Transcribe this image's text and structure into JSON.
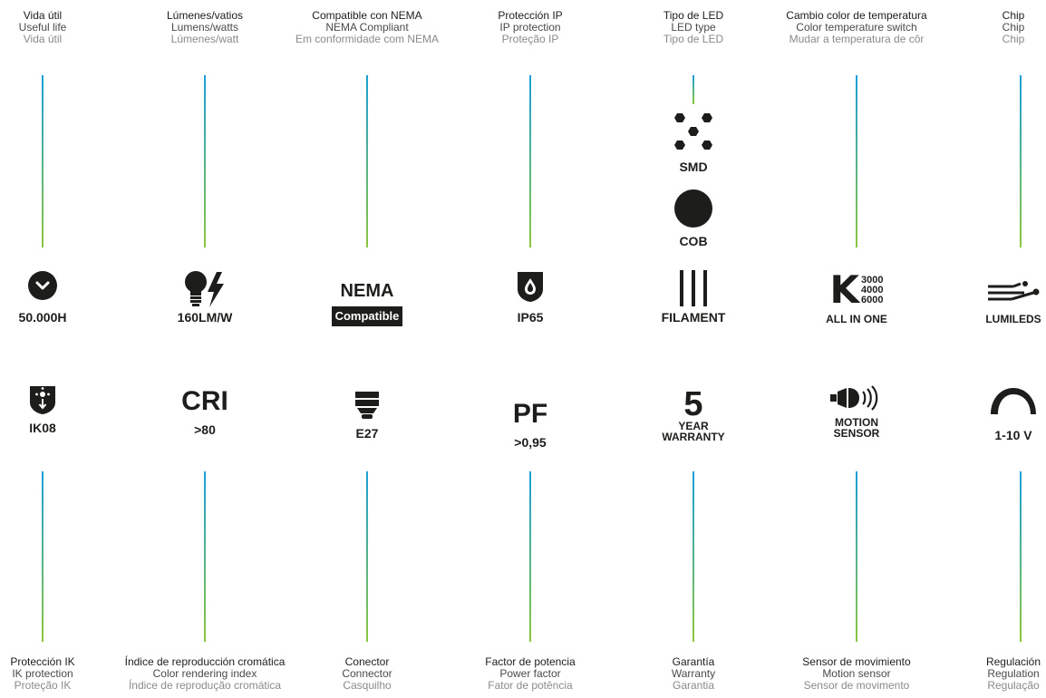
{
  "columns": [
    {
      "top": {
        "es": "Vida útil",
        "en": "Useful life",
        "pt": "Vida útil"
      },
      "top_feature": {
        "icon": "clock-icon",
        "value": "50.000H"
      },
      "bottom_feature": {
        "icon": "impact-shield-icon",
        "value": "IK08"
      },
      "bottom": {
        "es": "Protección IK",
        "en": "IK protection",
        "pt": "Proteção IK"
      }
    },
    {
      "top": {
        "es": "Lúmenes/vatios",
        "en": "Lumens/watts",
        "pt": "Lúmenes/watt"
      },
      "top_feature": {
        "icon": "bulb-lightning-icon",
        "value": "160LM/W"
      },
      "bottom_feature": {
        "icon": "cri-text-icon",
        "big": "CRI",
        "value": ">80"
      },
      "bottom": {
        "es": "Índice de reproducción cromática",
        "en": "Color rendering index",
        "pt": "Índice de reprodução cromática"
      }
    },
    {
      "top": {
        "es": "Compatible con NEMA",
        "en": "NEMA Compliant",
        "pt": "Em conformidade com NEMA"
      },
      "top_feature": {
        "title": "NEMA",
        "badge": "Compatible"
      },
      "bottom_feature": {
        "icon": "e27-socket-icon",
        "value": "E27"
      },
      "bottom": {
        "es": "Conector",
        "en": "Connector",
        "pt": "Casquilho"
      }
    },
    {
      "top": {
        "es": "Protección IP",
        "en": "IP protection",
        "pt": "Proteção IP"
      },
      "top_feature": {
        "icon": "water-drop-shield-icon",
        "value": "IP65"
      },
      "bottom_feature": {
        "icon": "pf-text-icon",
        "big": "PF",
        "value": ">0,95"
      },
      "bottom": {
        "es": "Factor de potencia",
        "en": "Power factor",
        "pt": "Fator de potência"
      }
    },
    {
      "top": {
        "es": "Tipo de LED",
        "en": "LED type",
        "pt": "Tipo de LED"
      },
      "led_types": [
        {
          "icon": "smd-hexagons-icon",
          "value": "SMD"
        },
        {
          "icon": "cob-circle-icon",
          "value": "COB"
        }
      ],
      "top_feature": {
        "icon": "filament-lines-icon",
        "value": "FILAMENT"
      },
      "bottom_feature": {
        "big": "5",
        "line1": "YEAR",
        "line2": "WARRANTY"
      },
      "bottom": {
        "es": "Garantía",
        "en": "Warranty",
        "pt": "Garantia"
      }
    },
    {
      "top": {
        "es": "Cambio color de temperatura",
        "en": "Color temperature switch",
        "pt": "Mudar a temperatura de côr"
      },
      "top_feature": {
        "icon": "kelvin-icon",
        "k": "K",
        "temps": [
          "3000",
          "4000",
          "6000"
        ],
        "value": "ALL IN ONE"
      },
      "bottom_feature": {
        "icon": "motion-sensor-icon",
        "line1": "MOTION",
        "line2": "SENSOR"
      },
      "bottom": {
        "es": "Sensor de movimiento",
        "en": "Motion sensor",
        "pt": "Sensor de movimento"
      }
    },
    {
      "top": {
        "es": "Chip",
        "en": "Chip",
        "pt": "Chip"
      },
      "top_feature": {
        "icon": "chip-circuit-icon",
        "value": "LUMILEDS"
      },
      "bottom_feature": {
        "icon": "dimmer-arc-icon",
        "value": "1-10 V"
      },
      "bottom": {
        "es": "Regulación",
        "en": "Regulation",
        "pt": "Regulação"
      }
    }
  ],
  "colors": {
    "line_top": "#1a9fd8",
    "line_bottom": "#8cc63f",
    "text": "#1d1d1b"
  }
}
